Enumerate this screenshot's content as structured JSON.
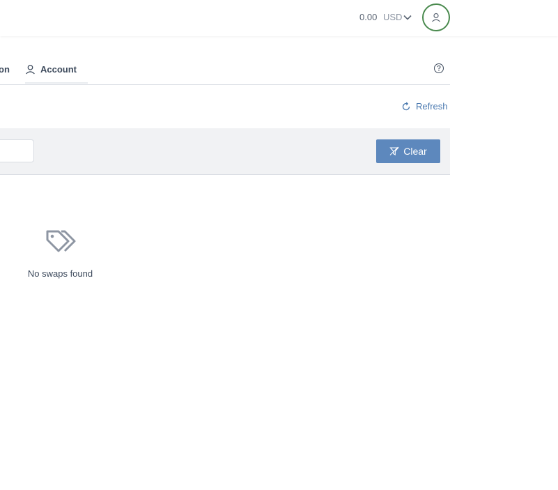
{
  "header": {
    "balance": "0.00",
    "currency": "USD",
    "icons": {
      "currency_dropdown": "chevron-down-icon",
      "avatar": "user-icon"
    }
  },
  "tabs": {
    "partial_label": "on",
    "account_label": "Account",
    "icons": {
      "account": "user-icon",
      "help": "help-circle-icon"
    }
  },
  "toolbar": {
    "refresh_label": "Refresh",
    "refresh_icon": "refresh-icon"
  },
  "filter": {
    "input_value": "",
    "clear_label": "Clear",
    "clear_icon": "filter-clear-icon"
  },
  "empty_state": {
    "icon": "tags-icon",
    "message": "No swaps found"
  },
  "colors": {
    "accent": "#5d88bd",
    "link": "#4b7ab0",
    "avatar_ring": "#4a8a4e",
    "filter_bg": "#f1f2f4"
  }
}
